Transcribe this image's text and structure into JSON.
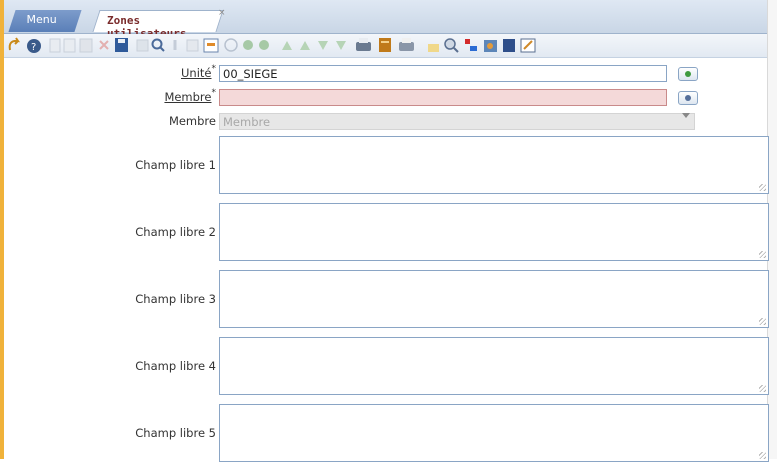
{
  "tabs": {
    "menu_label": "Menu",
    "active_label": "Zones utilisateurs",
    "close_glyph": "×"
  },
  "toolbar": {
    "icons": [
      "undo-icon",
      "help-icon",
      "new-record-icon",
      "copy-icon",
      "paste-icon",
      "delete-icon",
      "save-icon",
      "duplicate-icon",
      "search-icon",
      "attachment-icon",
      "note-icon",
      "window-icon",
      "history-icon",
      "prev-record-icon",
      "next-record-icon",
      "first-record-icon",
      "up-icon",
      "down-icon",
      "last-record-icon",
      "print-icon",
      "report-icon",
      "print-preview-icon",
      "lock-icon",
      "zoom-icon",
      "export-icon",
      "tools-icon",
      "book-icon",
      "edit-icon"
    ]
  },
  "form": {
    "unite_label": "Unité",
    "unite_value": "00_SIEGE",
    "membre_label": "Membre",
    "membre_value": "",
    "membre_select_label": "Membre",
    "membre_select_placeholder": "Membre",
    "required_mark": "*",
    "champ_labels": [
      "Champ libre 1",
      "Champ libre 2",
      "Champ libre 3",
      "Champ libre 4",
      "Champ libre 5"
    ]
  },
  "colors": {
    "accent_frame": "#f0b23a",
    "tab_active_text": "#7a2b2b",
    "error_field": "#f4d9d9"
  }
}
